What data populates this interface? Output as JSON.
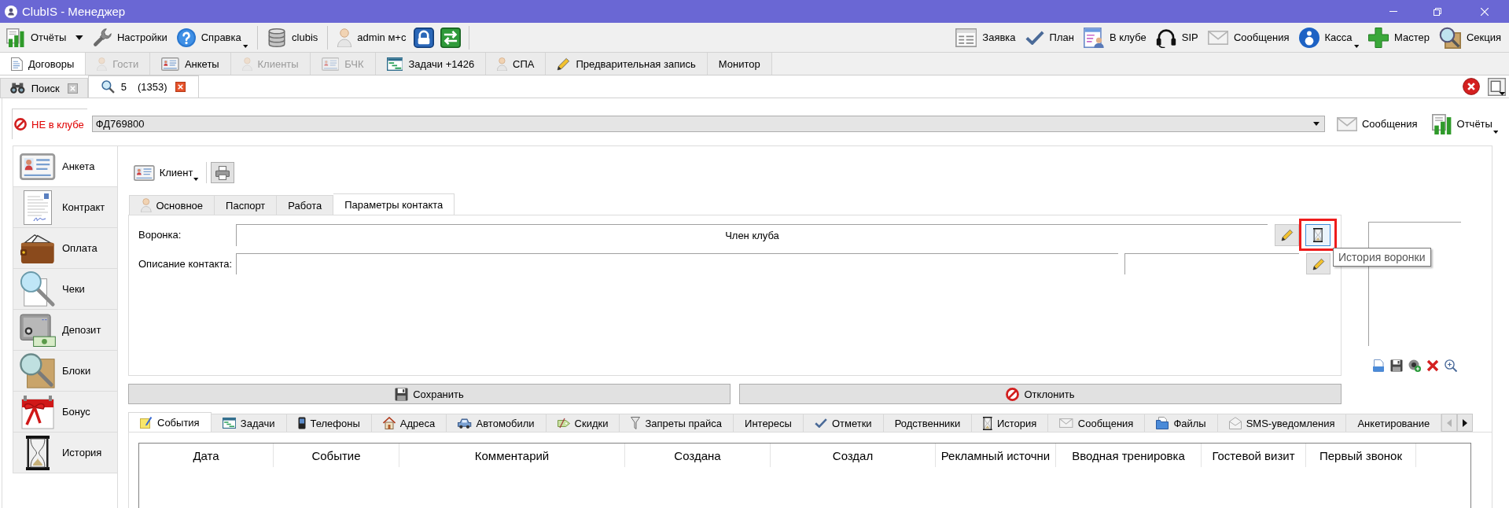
{
  "window": {
    "title": "ClubIS - Менеджер"
  },
  "toolbar": {
    "left": [
      {
        "label": "Отчёты",
        "dropdown": true
      },
      {
        "label": "Настройки",
        "dropdown": false
      },
      {
        "label": "Справка",
        "dropdown": true
      },
      {
        "label": "clubis",
        "dropdown": false
      },
      {
        "label": "admin м+с",
        "dropdown": false
      }
    ],
    "right": [
      {
        "label": "Заявка",
        "dropdown": false
      },
      {
        "label": "План",
        "dropdown": false
      },
      {
        "label": "В клубе",
        "dropdown": false
      },
      {
        "label": "SIP",
        "dropdown": false
      },
      {
        "label": "Сообщения",
        "dropdown": false
      },
      {
        "label": "Касса",
        "dropdown": true
      },
      {
        "label": "Мастер",
        "dropdown": false
      },
      {
        "label": "Секция",
        "dropdown": false
      }
    ]
  },
  "main_tabs": [
    {
      "label": "Договоры",
      "selected": true,
      "disabled": false
    },
    {
      "label": "Гости",
      "selected": false,
      "disabled": true
    },
    {
      "label": "Анкеты",
      "selected": false,
      "disabled": false
    },
    {
      "label": "Клиенты",
      "selected": false,
      "disabled": true
    },
    {
      "label": "БЧК",
      "selected": false,
      "disabled": true
    },
    {
      "label": "Задачи +1426",
      "selected": false,
      "disabled": false
    },
    {
      "label": "СПА",
      "selected": false,
      "disabled": false
    },
    {
      "label": "Предварительная запись",
      "selected": false,
      "disabled": false
    },
    {
      "label": "Монитор",
      "selected": false,
      "disabled": false
    }
  ],
  "document_tabs": [
    {
      "label": "Поиск",
      "selected": false
    },
    {
      "label": "5",
      "count": "(1353)",
      "selected": true
    }
  ],
  "client_bar": {
    "status": "НЕ в клубе",
    "card_number": "ФД769800",
    "buttons": [
      {
        "label": "Сообщения",
        "dropdown": false
      },
      {
        "label": "Отчёты",
        "dropdown": true
      }
    ]
  },
  "sidebar": {
    "items": [
      {
        "label": "Анкета",
        "selected": true
      },
      {
        "label": "Контракт",
        "selected": false
      },
      {
        "label": "Оплата",
        "selected": false
      },
      {
        "label": "Чеки",
        "selected": false
      },
      {
        "label": "Депозит",
        "selected": false
      },
      {
        "label": "Блоки",
        "selected": false
      },
      {
        "label": "Бонус",
        "selected": false
      },
      {
        "label": "История",
        "selected": false
      }
    ]
  },
  "client_menu": {
    "label": "Клиент",
    "dropdown": true
  },
  "form_tabs": [
    {
      "label": "Основное",
      "selected": false
    },
    {
      "label": "Паспорт",
      "selected": false
    },
    {
      "label": "Работа",
      "selected": false
    },
    {
      "label": "Параметры контакта",
      "selected": true
    }
  ],
  "form": {
    "funnel": {
      "label": "Воронка:",
      "value": "Член клуба",
      "history_highlighted": true
    },
    "contact_description": {
      "label": "Описание контакта:"
    }
  },
  "tooltip": {
    "text": "История воронки"
  },
  "actions": [
    {
      "label": "Сохранить"
    },
    {
      "label": "Отклонить"
    }
  ],
  "detail_tabs": [
    {
      "label": "События",
      "selected": true
    },
    {
      "label": "Задачи",
      "selected": false
    },
    {
      "label": "Телефоны",
      "selected": false
    },
    {
      "label": "Адреса",
      "selected": false
    },
    {
      "label": "Автомобили",
      "selected": false
    },
    {
      "label": "Скидки",
      "selected": false
    },
    {
      "label": "Запреты прайса",
      "selected": false
    },
    {
      "label": "Интересы",
      "selected": false
    },
    {
      "label": "Отметки",
      "selected": false
    },
    {
      "label": "Родственники",
      "selected": false
    },
    {
      "label": "История",
      "selected": false
    },
    {
      "label": "Сообщения",
      "selected": false
    },
    {
      "label": "Файлы",
      "selected": false
    },
    {
      "label": "SMS-уведомления",
      "selected": false
    },
    {
      "label": "Анкетирование",
      "selected": false
    }
  ],
  "events_table": {
    "columns": [
      "Дата",
      "Событие",
      "Комментарий",
      "Создана",
      "Создал",
      "Рекламный источни",
      "Вводная тренировка",
      "Гостевой визит",
      "Первый звонок"
    ]
  }
}
